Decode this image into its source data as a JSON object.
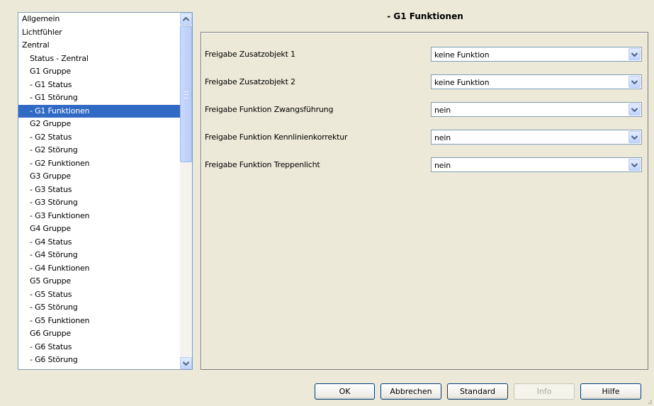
{
  "tree": {
    "items": [
      {
        "label": "Allgemein",
        "level": 0
      },
      {
        "label": "Lichtfühler",
        "level": 0
      },
      {
        "label": "Zentral",
        "level": 0
      },
      {
        "label": "Status - Zentral",
        "level": 1
      },
      {
        "label": "G1 Gruppe",
        "level": 1
      },
      {
        "label": "- G1 Status",
        "level": 1
      },
      {
        "label": "- G1 Störung",
        "level": 1
      },
      {
        "label": "- G1 Funktionen",
        "level": 1,
        "selected": true
      },
      {
        "label": "G2 Gruppe",
        "level": 1
      },
      {
        "label": "- G2 Status",
        "level": 1
      },
      {
        "label": "- G2 Störung",
        "level": 1
      },
      {
        "label": "- G2 Funktionen",
        "level": 1
      },
      {
        "label": "G3 Gruppe",
        "level": 1
      },
      {
        "label": "- G3 Status",
        "level": 1
      },
      {
        "label": "- G3 Störung",
        "level": 1
      },
      {
        "label": "- G3 Funktionen",
        "level": 1
      },
      {
        "label": "G4 Gruppe",
        "level": 1
      },
      {
        "label": "- G4 Status",
        "level": 1
      },
      {
        "label": "- G4 Störung",
        "level": 1
      },
      {
        "label": "- G4 Funktionen",
        "level": 1
      },
      {
        "label": "G5 Gruppe",
        "level": 1
      },
      {
        "label": "- G5 Status",
        "level": 1
      },
      {
        "label": "- G5 Störung",
        "level": 1
      },
      {
        "label": "- G5 Funktionen",
        "level": 1
      },
      {
        "label": "G6 Gruppe",
        "level": 1
      },
      {
        "label": "- G6 Status",
        "level": 1
      },
      {
        "label": "- G6 Störung",
        "level": 1
      }
    ]
  },
  "page": {
    "title": "- G1 Funktionen"
  },
  "params": [
    {
      "label": "Freigabe Zusatzobjekt 1",
      "value": "keine Funktion"
    },
    {
      "label": "Freigabe Zusatzobjekt 2",
      "value": "keine Funktion"
    },
    {
      "label": "Freigabe Funktion Zwangsführung",
      "value": "nein"
    },
    {
      "label": "Freigabe Funktion Kennlinienkorrektur",
      "value": "nein"
    },
    {
      "label": "Freigabe Funktion Treppenlicht",
      "value": "nein"
    }
  ],
  "buttons": {
    "ok": "OK",
    "cancel": "Abbrechen",
    "standard": "Standard",
    "info": "Info",
    "help": "Hilfe"
  },
  "colors": {
    "selection": "#316ac5",
    "background": "#ece9d8",
    "border": "#7f9db9"
  }
}
